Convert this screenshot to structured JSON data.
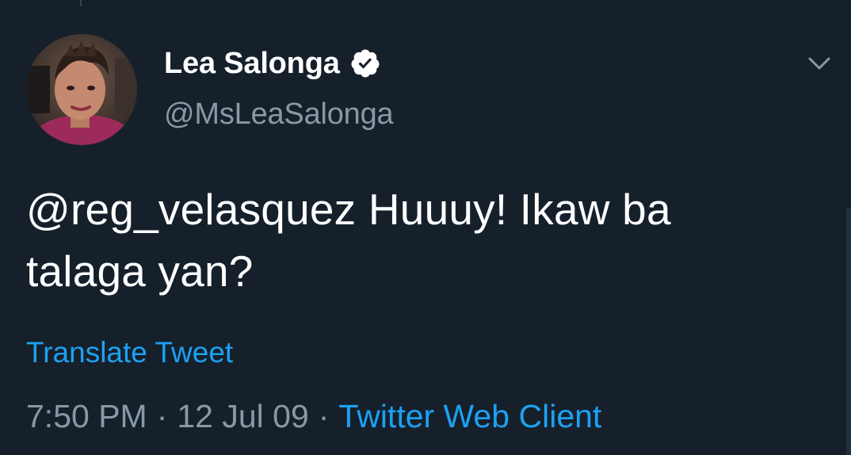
{
  "tweet": {
    "author": {
      "display_name": "Lea Salonga",
      "handle": "@MsLeaSalonga",
      "verified": true,
      "avatar_icon": "profile-photo"
    },
    "text_line1": "@reg_velasquez Huuuy! Ikaw ba",
    "text_line2": "talaga yan?",
    "translate_label": "Translate Tweet",
    "time": "7:50 PM",
    "separator": "·",
    "date": "12 Jul 09",
    "source": "Twitter Web Client",
    "menu_icon": "chevron-down-icon"
  },
  "colors": {
    "background": "#15202b",
    "primary_text": "#ffffff",
    "secondary_text": "#8899a6",
    "accent": "#1da1f2"
  }
}
